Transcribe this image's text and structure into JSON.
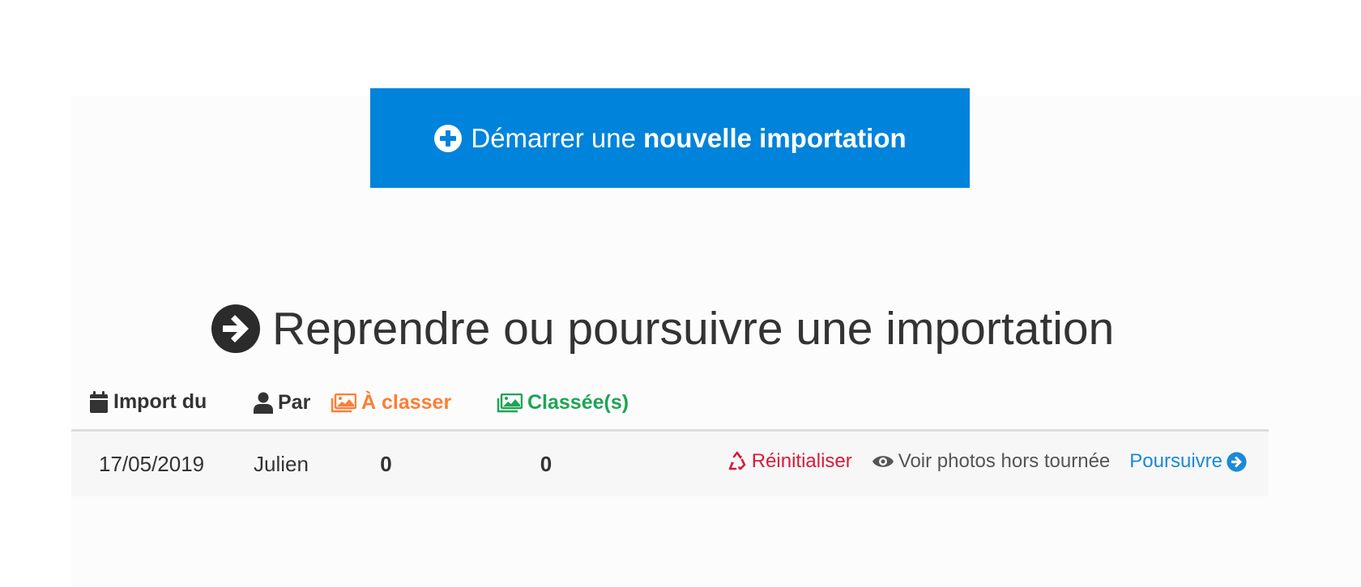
{
  "new_import": {
    "label_prefix": "Démarrer une",
    "label_strong": "nouvelle importation",
    "color": "#0083db"
  },
  "resume": {
    "title": "Reprendre ou poursuivre une importation"
  },
  "table": {
    "headers": {
      "date": "Import du",
      "user": "Par",
      "to_classify": "À classer",
      "classified": "Classée(s)"
    },
    "colors": {
      "to_classify": "#fd7e35",
      "classified": "#1ea454"
    },
    "rows": [
      {
        "date": "17/05/2019",
        "user": "Julien",
        "to_classify": "0",
        "classified": "0",
        "actions": {
          "reset": "Réinitialiser",
          "view": "Voir photos hors tournée",
          "continue": "Poursuivre"
        }
      }
    ]
  },
  "icons": {
    "new_import": "plus-circle-icon",
    "resume": "arrow-circle-right-icon",
    "date": "calendar-icon",
    "user": "user-icon",
    "to_classify": "images-icon",
    "classified": "images-icon",
    "reset": "recycle-icon",
    "view": "eye-icon",
    "continue": "arrow-circle-right-icon"
  }
}
